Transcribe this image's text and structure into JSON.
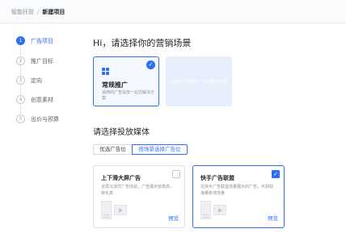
{
  "breadcrumb": {
    "root": "智能托管",
    "separator": "/",
    "current": "新建项目"
  },
  "steps": [
    {
      "num": "1",
      "label": "广告项目",
      "active": true
    },
    {
      "num": "2",
      "label": "推广目标",
      "active": false
    },
    {
      "num": "3",
      "label": "定向",
      "active": false
    },
    {
      "num": "4",
      "label": "创意素材",
      "active": false
    },
    {
      "num": "5",
      "label": "出价与预算",
      "active": false
    }
  ],
  "scene": {
    "heading": "Hi，请选择你的营销场景",
    "card": {
      "title": "常规推广",
      "desc": "适用的广告投放一站式解决方案",
      "check": "✓"
    },
    "ghost_text": "适用于广告投放·一站式解决方案"
  },
  "media": {
    "heading": "请选择投放媒体",
    "tabs": [
      "优选广告位",
      "按场景选择广告位"
    ],
    "cards": [
      {
        "title": "上下滑大屏广告",
        "desc": "全屏沉浸式广告体验，广告展示效率高，转化高",
        "preview": "预览",
        "checked": false
      },
      {
        "title": "快手广告联盟",
        "desc": "在快手广告联盟流量展示的广告，可获取海量新增流量",
        "preview": "预览",
        "checked": true,
        "check": "✓"
      }
    ]
  },
  "colors": {
    "accent": "#2e6ff2"
  }
}
